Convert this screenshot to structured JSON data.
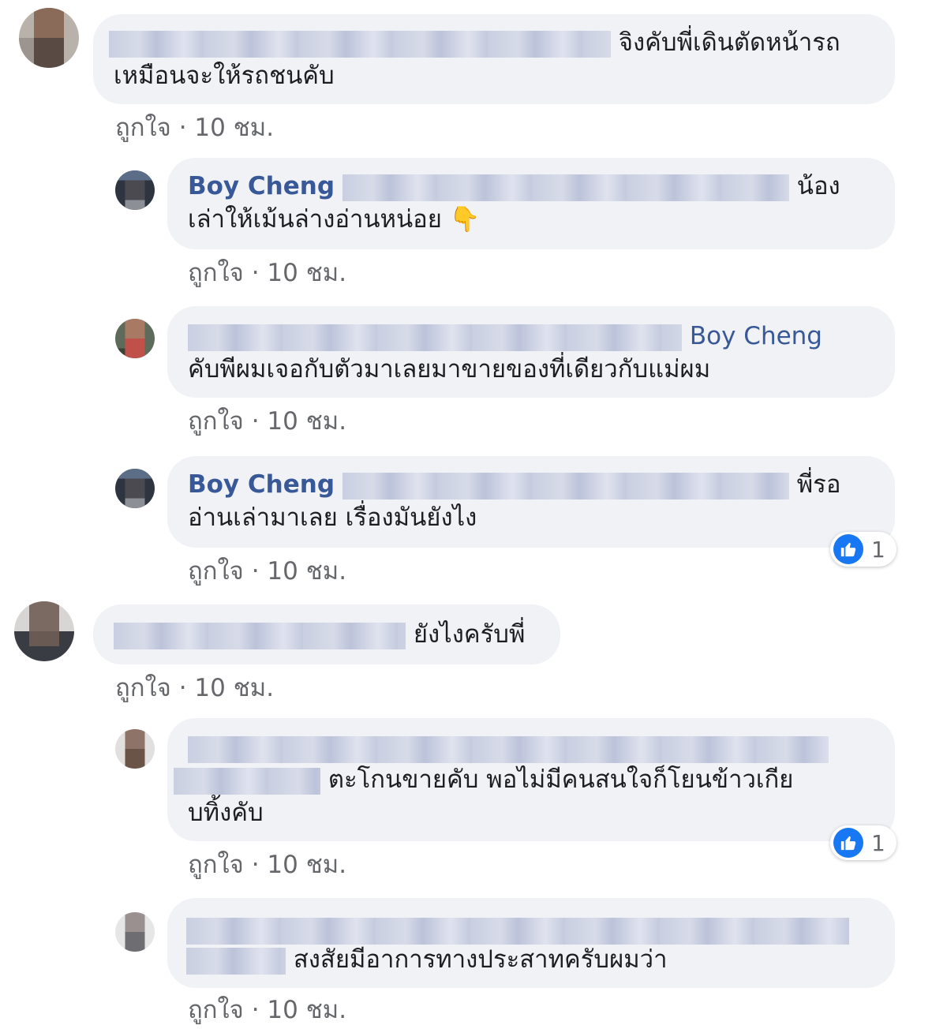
{
  "comments": [
    {
      "tail": "จิงคับพี่เดินตัดหน้ารถ",
      "line2": "เหมือนจะให้รถชนคับ",
      "like": "ถูกใจ",
      "time": "10 ชม."
    },
    {
      "author": "Boy Cheng",
      "tail": "น้อง",
      "line2": "เล่าให้เม้นล่างอ่านหน่อย",
      "emoji": "👇",
      "like": "ถูกใจ",
      "time": "10 ชม."
    },
    {
      "mention": "Boy Cheng",
      "line2": "คับพีผมเจอกับตัวมาเลยมาขายของที่เดียวกับแม่ผม",
      "like": "ถูกใจ",
      "time": "10 ชม."
    },
    {
      "author": "Boy Cheng",
      "tail": "พี่รอ",
      "line2": "อ่านเล่ามาเลย เรื่องมันยังไง",
      "like": "ถูกใจ",
      "time": "10 ชม.",
      "reaction_count": "1"
    },
    {
      "tail": "ยังไงครับพี่",
      "like": "ถูกใจ",
      "time": "10 ชม."
    },
    {
      "tail": "ตะโกนขายคับ พอไม่มีคนสนใจก็โยนข้าวเกีย",
      "line3": "บทิ้งคับ",
      "like": "ถูกใจ",
      "time": "10 ชม.",
      "reaction_count": "1"
    },
    {
      "tail": "สงสัยมีอาการทางประสาทครับผมว่า",
      "like": "ถูกใจ",
      "time": "10 ชม."
    }
  ],
  "separator": "·",
  "colors": {
    "bubble": "#f0f2f5",
    "name": "#385898",
    "meta": "#65676b",
    "like_blue": "#1877f2"
  }
}
